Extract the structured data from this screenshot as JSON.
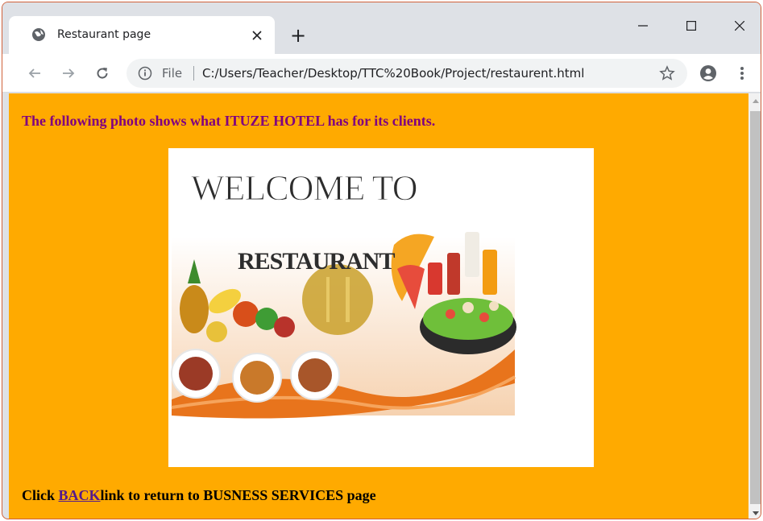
{
  "browser": {
    "tab": {
      "title": "Restaurant page",
      "favicon": "globe-icon"
    },
    "new_tab_symbol": "+",
    "window_controls": [
      "minimize-icon",
      "maximize-icon",
      "close-icon"
    ],
    "omnibox": {
      "scheme_label": "File",
      "url": "C:/Users/Teacher/Desktop/TTC%20Book/Project/restaurent.html"
    }
  },
  "page": {
    "background_color": "#ffaa00",
    "intro_text": "The following photo shows what ITUZE HOTEL has for its clients.",
    "intro_color": "#800080",
    "banner": {
      "heading": "WELCOME TO",
      "subheading": "RESTAURANT"
    },
    "footer": {
      "prefix": "Click ",
      "link_text": "BACK",
      "suffix": "link to return to BUSNESS SERVICES page"
    }
  }
}
